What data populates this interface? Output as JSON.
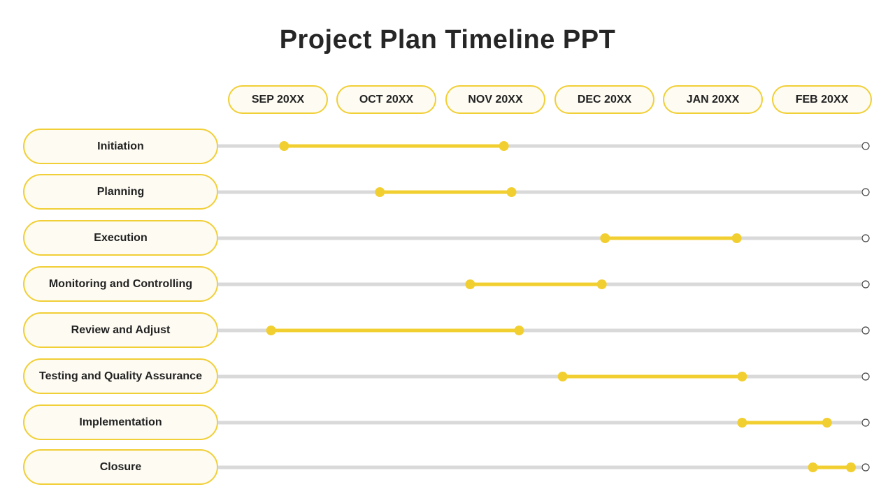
{
  "title": "Project Plan Timeline PPT",
  "colors": {
    "accent": "#f2cf30",
    "pill_border": "#f1cf36",
    "pill_fill": "#fdfbf2",
    "track": "#d9d9d9",
    "end_marker": "#444444",
    "text": "#222222"
  },
  "chart_data": {
    "type": "gantt",
    "title": "Project Plan Timeline PPT",
    "x_unit": "months (0 = SEP 20XX center, 1 = OCT 20XX center, ...)",
    "categories": [
      "SEP 20XX",
      "OCT 20XX",
      "NOV 20XX",
      "DEC 20XX",
      "JAN 20XX",
      "FEB 20XX"
    ],
    "x_range": [
      -0.55,
      5.42
    ],
    "tasks": [
      {
        "name": "Initiation",
        "start": 0.06,
        "end": 2.08
      },
      {
        "name": "Planning",
        "start": 0.94,
        "end": 2.15
      },
      {
        "name": "Execution",
        "start": 3.01,
        "end": 4.22
      },
      {
        "name": "Monitoring and Controlling",
        "start": 1.77,
        "end": 2.98
      },
      {
        "name": "Review and Adjust",
        "start": -0.06,
        "end": 2.22
      },
      {
        "name": "Testing and Quality Assurance",
        "start": 2.62,
        "end": 4.27
      },
      {
        "name": "Implementation",
        "start": 4.27,
        "end": 5.05
      },
      {
        "name": "Closure",
        "start": 4.92,
        "end": 5.27
      }
    ],
    "grid": false,
    "legend": "none"
  }
}
